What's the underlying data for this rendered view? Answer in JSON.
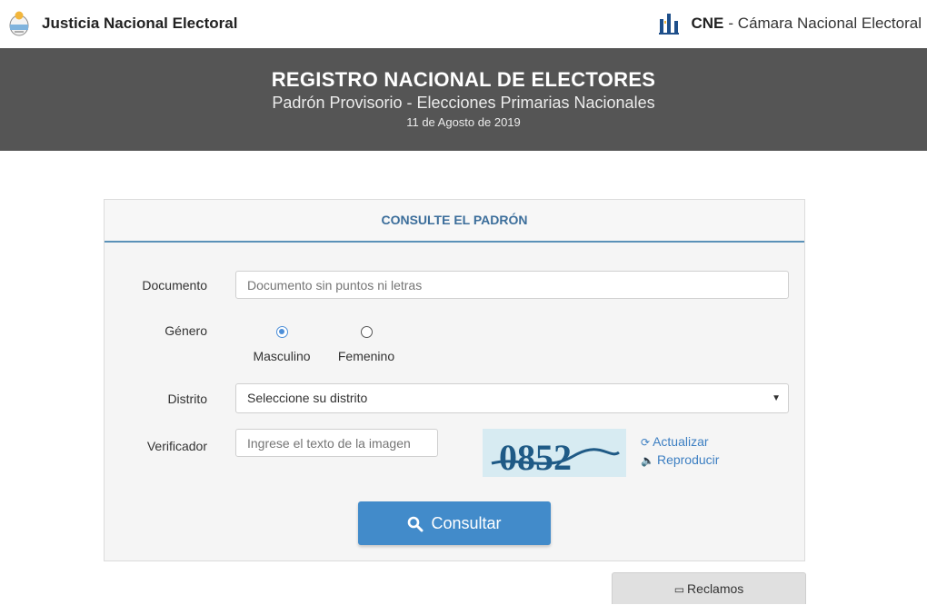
{
  "header": {
    "left_title": "Justicia Nacional Electoral",
    "right_abbr": "CNE",
    "right_rest": "- Cámara Nacional Electoral"
  },
  "banner": {
    "title": "REGISTRO NACIONAL DE ELECTORES",
    "subtitle": "Padrón Provisorio - Elecciones Primarias Nacionales",
    "date": "11 de Agosto de 2019"
  },
  "form": {
    "heading": "CONSULTE EL PADRÓN",
    "documento": {
      "label": "Documento",
      "placeholder": "Documento sin puntos ni letras",
      "value": ""
    },
    "genero": {
      "label": "Género",
      "options": [
        {
          "label": "Masculino",
          "checked": true
        },
        {
          "label": "Femenino",
          "checked": false
        }
      ]
    },
    "distrito": {
      "label": "Distrito",
      "selected": "Seleccione su distrito"
    },
    "verificador": {
      "label": "Verificador",
      "placeholder": "Ingrese el texto de la imagen",
      "captcha_text": "0852",
      "refresh_label": "Actualizar",
      "audio_label": "Reproducir"
    },
    "submit_label": "Consultar"
  },
  "footer": {
    "reclamos_label": "Reclamos"
  },
  "colors": {
    "banner_bg": "#555555",
    "accent": "#428bca",
    "heading": "#3c6e9b",
    "link": "#3d7fc2"
  }
}
